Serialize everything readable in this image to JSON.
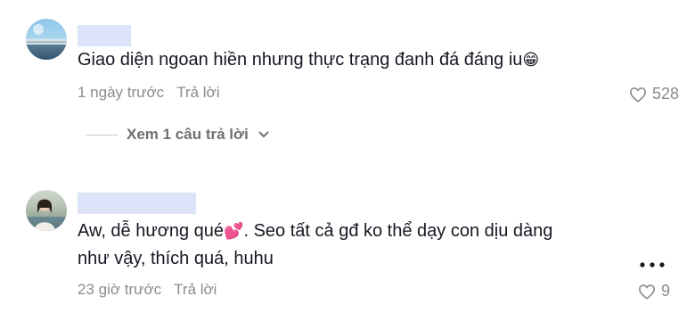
{
  "comments": [
    {
      "text": "Giao diện ngoan hiền nhưng thực trạng đanh đá đáng iu",
      "emoji": "😁",
      "time": "1 ngày trước",
      "reply_label": "Trả lời",
      "likes": "528",
      "view_replies": "Xem 1 câu trả lời"
    },
    {
      "text_part1": "Aw, dễ hương qué",
      "emoji": "💕",
      "text_part2": ". Seo tất cả gđ ko thể dạy con dịu dàng như vậy, thích quá, huhu",
      "time": "23 giờ trước",
      "reply_label": "Trả lời",
      "likes": "9"
    }
  ],
  "icons": {
    "like": "heart-outline-icon",
    "expand": "chevron-down-icon",
    "more": "more-horizontal-icon"
  },
  "colors": {
    "text": "#161823",
    "muted": "#8a8b91",
    "username_mask": "#dde3f8"
  }
}
